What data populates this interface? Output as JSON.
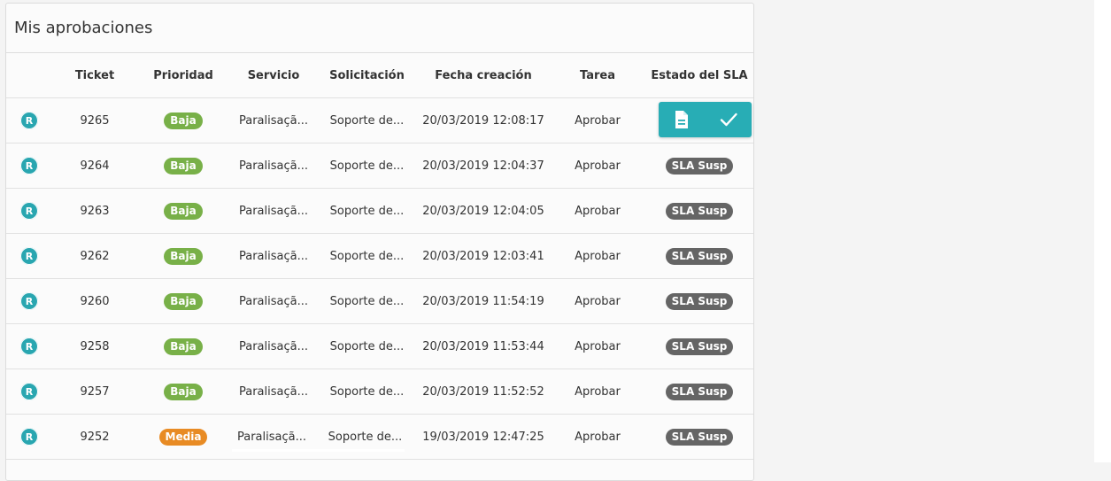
{
  "panel": {
    "title": "Mis aprobaciones"
  },
  "headers": {
    "ticket": "Ticket",
    "priority": "Prioridad",
    "service": "Servicio",
    "request": "Solicitación",
    "created": "Fecha creación",
    "task": "Tarea",
    "sla_status": "Estado del SLA"
  },
  "colors": {
    "teal": "#28adb5",
    "baja": "#78b048",
    "media": "#e88b24",
    "sla": "#656565"
  },
  "rows": [
    {
      "icon": "R",
      "ticket": "9265",
      "priority": "Baja",
      "priority_color": "#78b048",
      "service": "Paralisaçã...",
      "request": "Soporte de...",
      "created": "20/03/2019 12:08:17",
      "task": "Aprobar",
      "sla": "",
      "hover": true
    },
    {
      "icon": "R",
      "ticket": "9264",
      "priority": "Baja",
      "priority_color": "#78b048",
      "service": "Paralisaçã...",
      "request": "Soporte de...",
      "created": "20/03/2019 12:04:37",
      "task": "Aprobar",
      "sla": "SLA Susp"
    },
    {
      "icon": "R",
      "ticket": "9263",
      "priority": "Baja",
      "priority_color": "#78b048",
      "service": "Paralisaçã...",
      "request": "Soporte de...",
      "created": "20/03/2019 12:04:05",
      "task": "Aprobar",
      "sla": "SLA Susp"
    },
    {
      "icon": "R",
      "ticket": "9262",
      "priority": "Baja",
      "priority_color": "#78b048",
      "service": "Paralisaçã...",
      "request": "Soporte de...",
      "created": "20/03/2019 12:03:41",
      "task": "Aprobar",
      "sla": "SLA Susp"
    },
    {
      "icon": "R",
      "ticket": "9260",
      "priority": "Baja",
      "priority_color": "#78b048",
      "service": "Paralisaçã...",
      "request": "Soporte de...",
      "created": "20/03/2019 11:54:19",
      "task": "Aprobar",
      "sla": "SLA Susp"
    },
    {
      "icon": "R",
      "ticket": "9258",
      "priority": "Baja",
      "priority_color": "#78b048",
      "service": "Paralisaçã...",
      "request": "Soporte de...",
      "created": "20/03/2019 11:53:44",
      "task": "Aprobar",
      "sla": "SLA Susp"
    },
    {
      "icon": "R",
      "ticket": "9257",
      "priority": "Baja",
      "priority_color": "#78b048",
      "service": "Paralisaçã...",
      "request": "Soporte de...",
      "created": "20/03/2019 11:52:52",
      "task": "Aprobar",
      "sla": "SLA Susp"
    },
    {
      "icon": "R",
      "ticket": "9252",
      "priority": "Media",
      "priority_color": "#e88b24",
      "service": "Paralisaçã...",
      "request": "Soporte de...",
      "created": "19/03/2019 12:47:25",
      "task": "Aprobar",
      "sla": "SLA Susp"
    }
  ],
  "row_actions": {
    "detail_icon": "document-icon",
    "approve_icon": "check-icon"
  }
}
